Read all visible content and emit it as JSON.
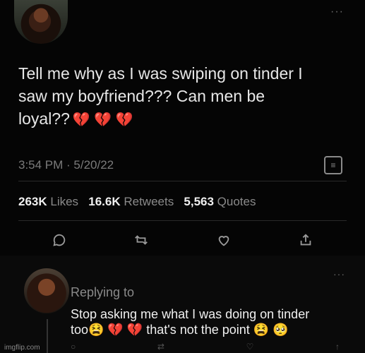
{
  "main_tweet": {
    "text_lines": [
      "Tell me why as I was swiping on tinder I",
      "saw my boyfriend??? Can men be",
      "loyal??"
    ],
    "emojis": "💔 💔 💔",
    "timestamp": "3:54 PM · 5/20/22",
    "stats": {
      "likes_count": "263K",
      "likes_label": "Likes",
      "retweets_count": "16.6K",
      "retweets_label": "Retweets",
      "quotes_count": "5,563",
      "quotes_label": "Quotes"
    },
    "more": "···"
  },
  "reply": {
    "replying_to": "Replying to",
    "text_line1": "Stop asking me what I was doing on tinder",
    "text_line2": "too😫 💔 💔  that's not the point 😫 🥺",
    "more": "···"
  },
  "watermark": "imgflip.com"
}
